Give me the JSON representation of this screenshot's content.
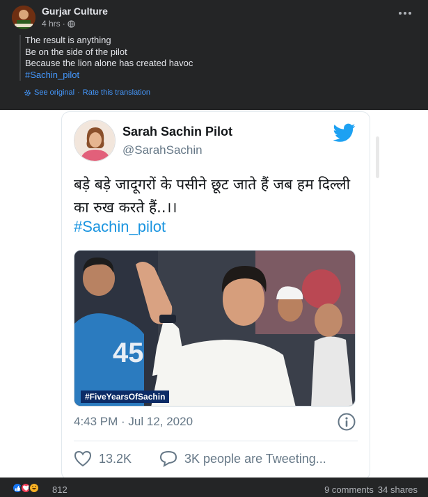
{
  "post": {
    "author": "Gurjar Culture",
    "time": "4 hrs",
    "time_sep": "·",
    "privacy_icon": "globe-icon",
    "translated_lines": [
      "The result is anything",
      "Be on the side of the pilot",
      "Because the lion alone has created havoc"
    ],
    "hashtag": "#Sachin_pilot",
    "see_original": "See original",
    "link_sep": "·",
    "rate_translation": "Rate this translation"
  },
  "tweet": {
    "name": "Sarah Sachin Pilot",
    "handle": "@SarahSachin",
    "text": "बड़े बड़े जादूगरों के पसीने छूट जाते हैं जब हम दिल्ली का रुख करते हैं..।।",
    "hashtag": "#Sachin_pilot",
    "photo_caption": "#FiveYearsOfSachin",
    "timestamp": "4:43 PM · Jul 12, 2020",
    "likes": "13.2K",
    "replies": "3K people are Tweeting...",
    "brand_color": "#1da1f2"
  },
  "footer": {
    "reaction_count": "812",
    "comments": "9 comments",
    "shares": "34 shares",
    "reaction_icons": [
      "like-icon",
      "love-icon",
      "haha-icon"
    ]
  }
}
